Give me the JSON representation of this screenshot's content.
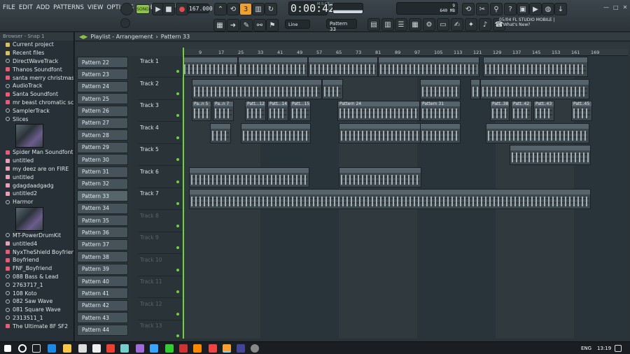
{
  "menu": [
    "FILE",
    "EDIT",
    "ADD",
    "PATTERNS",
    "VIEW",
    "OPTIONS",
    "TOOLS",
    "HELP"
  ],
  "transport": {
    "mode": "SONG",
    "tempo": "167.000",
    "time": "0:00:42",
    "time_sub": "M:S:CS",
    "cpu": "9",
    "mem": "640 MB",
    "cpu2": "0"
  },
  "news": {
    "line1": "05/04 FL STUDIO MOBILE |",
    "line2": "4 What's New?"
  },
  "toolbar": {
    "snap": "Line",
    "pattern_select": "Pattern 33"
  },
  "browser": {
    "title": "Browser - Snap 1",
    "items": [
      {
        "label": "Current project",
        "icon": "folder-icon"
      },
      {
        "label": "Recent files",
        "icon": "folder-icon"
      },
      {
        "label": "DirectWaveTrack",
        "icon": "gear-icon"
      },
      {
        "label": "Thanos Soundfont",
        "icon": "proj-icon"
      },
      {
        "label": "santa merry christmas",
        "icon": "proj-icon"
      },
      {
        "label": "AudioTrack",
        "icon": "gear-icon"
      },
      {
        "label": "Santa Soundfont",
        "icon": "proj-icon"
      },
      {
        "label": "mr beast chromatic scale",
        "icon": "proj-icon"
      },
      {
        "label": "SamplerTrack",
        "icon": "gear-icon"
      },
      {
        "label": "Slices",
        "icon": "gear-icon"
      },
      {
        "label": "",
        "thumb": true
      },
      {
        "label": "Spider Man Soundfont",
        "icon": "proj-icon"
      },
      {
        "label": "untitled",
        "icon": "doc-icon"
      },
      {
        "label": "my deez are on FIRE",
        "icon": "doc-icon"
      },
      {
        "label": "untitled",
        "icon": "doc-icon"
      },
      {
        "label": "gdagdaadgadg",
        "icon": "doc-icon"
      },
      {
        "label": "untitled2",
        "icon": "doc-icon"
      },
      {
        "label": "Harmor",
        "icon": "gear-icon"
      },
      {
        "label": "",
        "thumb": true
      },
      {
        "label": "MT-PowerDrumKit",
        "icon": "gear-icon"
      },
      {
        "label": "untitled4",
        "icon": "doc-icon"
      },
      {
        "label": "NyxTheShield Boyfriend",
        "icon": "proj-icon"
      },
      {
        "label": "Boyfriend",
        "icon": "proj-icon"
      },
      {
        "label": "FNF_Boyfriend",
        "icon": "proj-icon"
      },
      {
        "label": "088 Bass & Lead",
        "icon": "gear-icon"
      },
      {
        "label": "2763717_1",
        "icon": "gear-icon"
      },
      {
        "label": "108 Koto",
        "icon": "gear-icon"
      },
      {
        "label": "082 Saw Wave",
        "icon": "gear-icon"
      },
      {
        "label": "081 Square Wave",
        "icon": "gear-icon"
      },
      {
        "label": "2313511_1",
        "icon": "gear-icon"
      },
      {
        "label": "The Ultimate 8F SF2",
        "icon": "proj-icon"
      }
    ]
  },
  "playlist": {
    "title": "Playlist - Arrangement",
    "breadcrumb_sep": "›",
    "pattern": "Pattern 33"
  },
  "patterns": [
    "Pattern 22",
    "Pattern 23",
    "Pattern 24",
    "Pattern 25",
    "Pattern 26",
    "Pattern 27",
    "Pattern 28",
    "Pattern 29",
    "Pattern 30",
    "Pattern 31",
    "Pattern 32",
    "Pattern 33",
    "Pattern 34",
    "Pattern 35",
    "Pattern 36",
    "Pattern 37",
    "Pattern 38",
    "Pattern 39",
    "Pattern 40",
    "Pattern 41",
    "Pattern 42",
    "Pattern 43",
    "Pattern 44"
  ],
  "tracks": [
    "Track 1",
    "Track 2",
    "Track 3",
    "Track 4",
    "Track 5",
    "Track 6",
    "Track 7",
    "Track 8",
    "Track 9",
    "Track 10",
    "Track 11",
    "Track 12",
    "Track 13"
  ],
  "ruler": [
    "9",
    "17",
    "25",
    "33",
    "41",
    "49",
    "57",
    "65",
    "73",
    "81",
    "89",
    "97",
    "105",
    "113",
    "121",
    "129",
    "137",
    "145",
    "153",
    "161",
    "169"
  ],
  "clip_labels": {
    "t3a": "Pa..n 5",
    "t3b": "Pa..n 7",
    "t3c": "Patt...12",
    "t3d": "Patt...14",
    "t3e": "Patt...15",
    "t3f": "Pattern 24",
    "t3g": "Pattern 31",
    "t3h": "Patt..38",
    "t3i": "Patt..42",
    "t3j": "Patt..43",
    "t3k": "Patt..45"
  },
  "taskbar": {
    "lang": "ENG",
    "time": "13:19"
  }
}
